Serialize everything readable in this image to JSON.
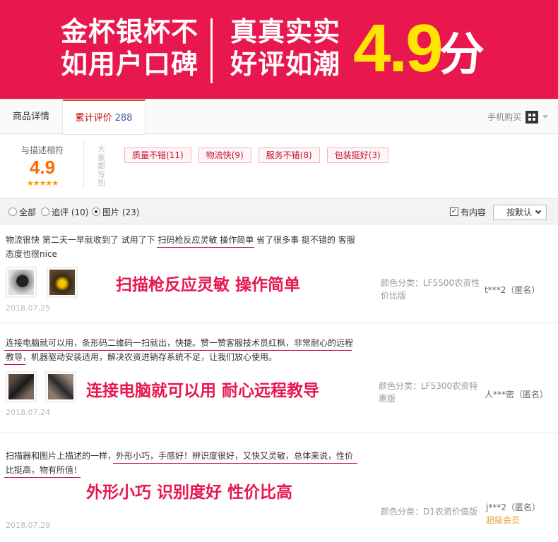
{
  "banner": {
    "line1": "金杯银杯不",
    "line2": "如用户口碑",
    "line3": "真真实实",
    "line4": "好评如潮",
    "score": "4.9",
    "unit": "分"
  },
  "tabs": {
    "detail": "商品详情",
    "review": "累计评价",
    "review_count": "288",
    "mobile": "手机购买"
  },
  "summary": {
    "rating_label": "与描述相符",
    "rating": "4.9",
    "stars": "★★★★★",
    "vertical_label": "大家都写到",
    "tags": [
      "质量不错(11)",
      "物流快(9)",
      "服务不错(8)",
      "包装挺好(3)"
    ]
  },
  "filter": {
    "all": "全部",
    "followup": "追评 (10)",
    "images": "图片 (23)",
    "selected": "images",
    "has_content": "有内容",
    "has_content_checked": true,
    "sort": "按默认"
  },
  "reviews": [
    {
      "text": "物流很快 第二天一早就收到了 试用了下 扫码枪反应灵敏 操作简单 省了很多事 挺不错的 客服态度也很nice",
      "callout": "扫描枪反应灵敏 操作简单",
      "spec": "颜色分类：LF5500农资性价比版",
      "user": "t***2（匿名）",
      "badge": "",
      "date": "2018.07.25"
    },
    {
      "text": "连接电脑就可以用，条形码二维码一扫就出，快捷。赞一赞客服技术员红枫，非常耐心的远程教导，机器驱动安装适用，解决农资进销存系统不足，让我们放心使用。",
      "callout": "连接电脑就可以用 耐心远程教导",
      "spec": "颜色分类：LF5300农资特惠版",
      "user": "人***密（匿名）",
      "badge": "",
      "date": "2018.07.24"
    },
    {
      "text": "扫描器和图片上描述的一样，外形小巧，手感好！辨识度很好，又快又灵敏，总体来说，性价比挺高，物有所值！",
      "callout": "外形小巧 识别度好 性价比高",
      "spec": "颜色分类：D1农资价值版",
      "user": "j***2（匿名）",
      "badge": "超级会员",
      "date": "2018.07.29"
    }
  ],
  "colors": {
    "banner_bg": "#e8174e",
    "score_yellow": "#ffe400",
    "accent_red": "#c0102a",
    "rating_orange": "#ff6a00"
  }
}
